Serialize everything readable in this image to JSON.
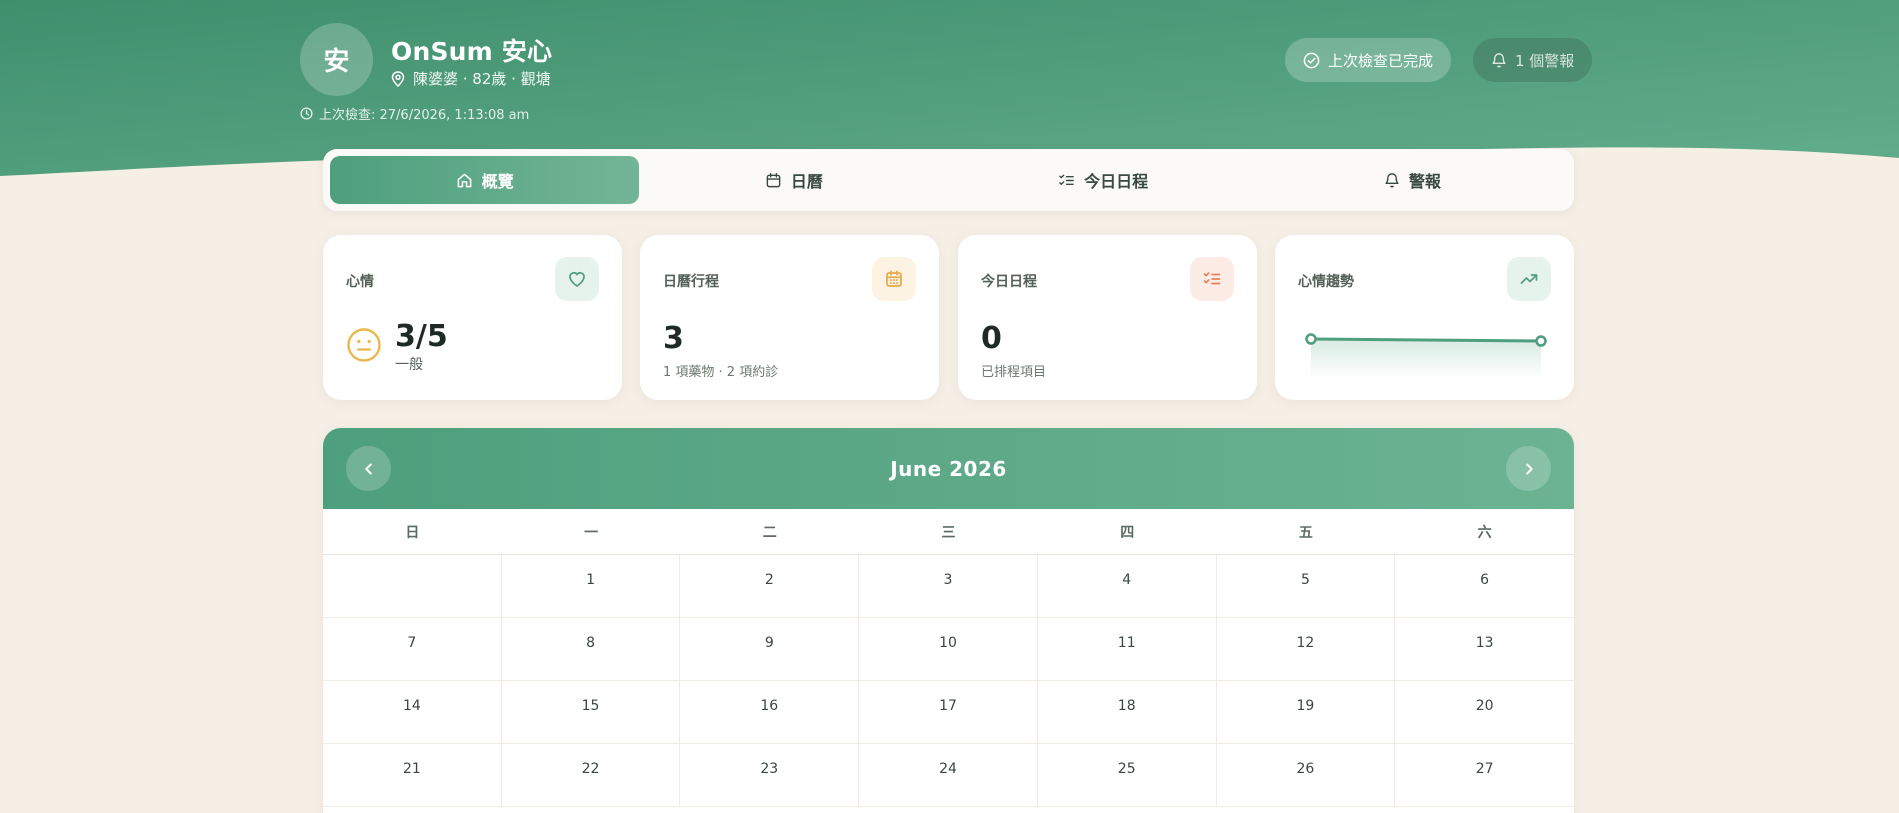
{
  "app": {
    "avatar_text": "安",
    "title": "OnSum 安心",
    "subtitle": "陳婆婆 · 82歲 · 觀塘",
    "last_check": "上次檢查: 27/6/2026, 1:13:08 am",
    "status_done": "上次檢查已完成",
    "alerts": "1 個警報"
  },
  "tabs": [
    {
      "label": "概覽",
      "icon": "home-icon",
      "active": true
    },
    {
      "label": "日曆",
      "icon": "calendar-icon",
      "active": false
    },
    {
      "label": "今日日程",
      "icon": "checklist-icon",
      "active": false
    },
    {
      "label": "警報",
      "icon": "bell-icon",
      "active": false
    }
  ],
  "cards": {
    "mood": {
      "label": "心情",
      "value": "3/5",
      "desc": "一般",
      "icon": "heart-icon"
    },
    "calendar": {
      "label": "日曆行程",
      "value": "3",
      "desc": "1 項藥物 · 2 項約診",
      "icon": "calendar-icon"
    },
    "today": {
      "label": "今日日程",
      "value": "0",
      "desc": "已排程項目",
      "icon": "checklist-icon"
    },
    "trend": {
      "label": "心情趨勢",
      "icon": "trending-up-icon",
      "points": [
        3.4,
        3.0
      ]
    }
  },
  "calendar": {
    "title": "June 2026",
    "weekdays": [
      "日",
      "一",
      "二",
      "三",
      "四",
      "五",
      "六"
    ],
    "days": [
      "",
      "1",
      "2",
      "3",
      "4",
      "5",
      "6",
      "7",
      "8",
      "9",
      "10",
      "11",
      "12",
      "13",
      "14",
      "15",
      "16",
      "17",
      "18",
      "19",
      "20",
      "21",
      "22",
      "23",
      "24",
      "25",
      "26",
      "27"
    ]
  },
  "colors": {
    "primary": "#4e9f7d",
    "background": "#f6efe6",
    "mood_face": "#e9b84c",
    "calendar_icon": "#e9a84c",
    "checklist_icon": "#e8805e"
  }
}
